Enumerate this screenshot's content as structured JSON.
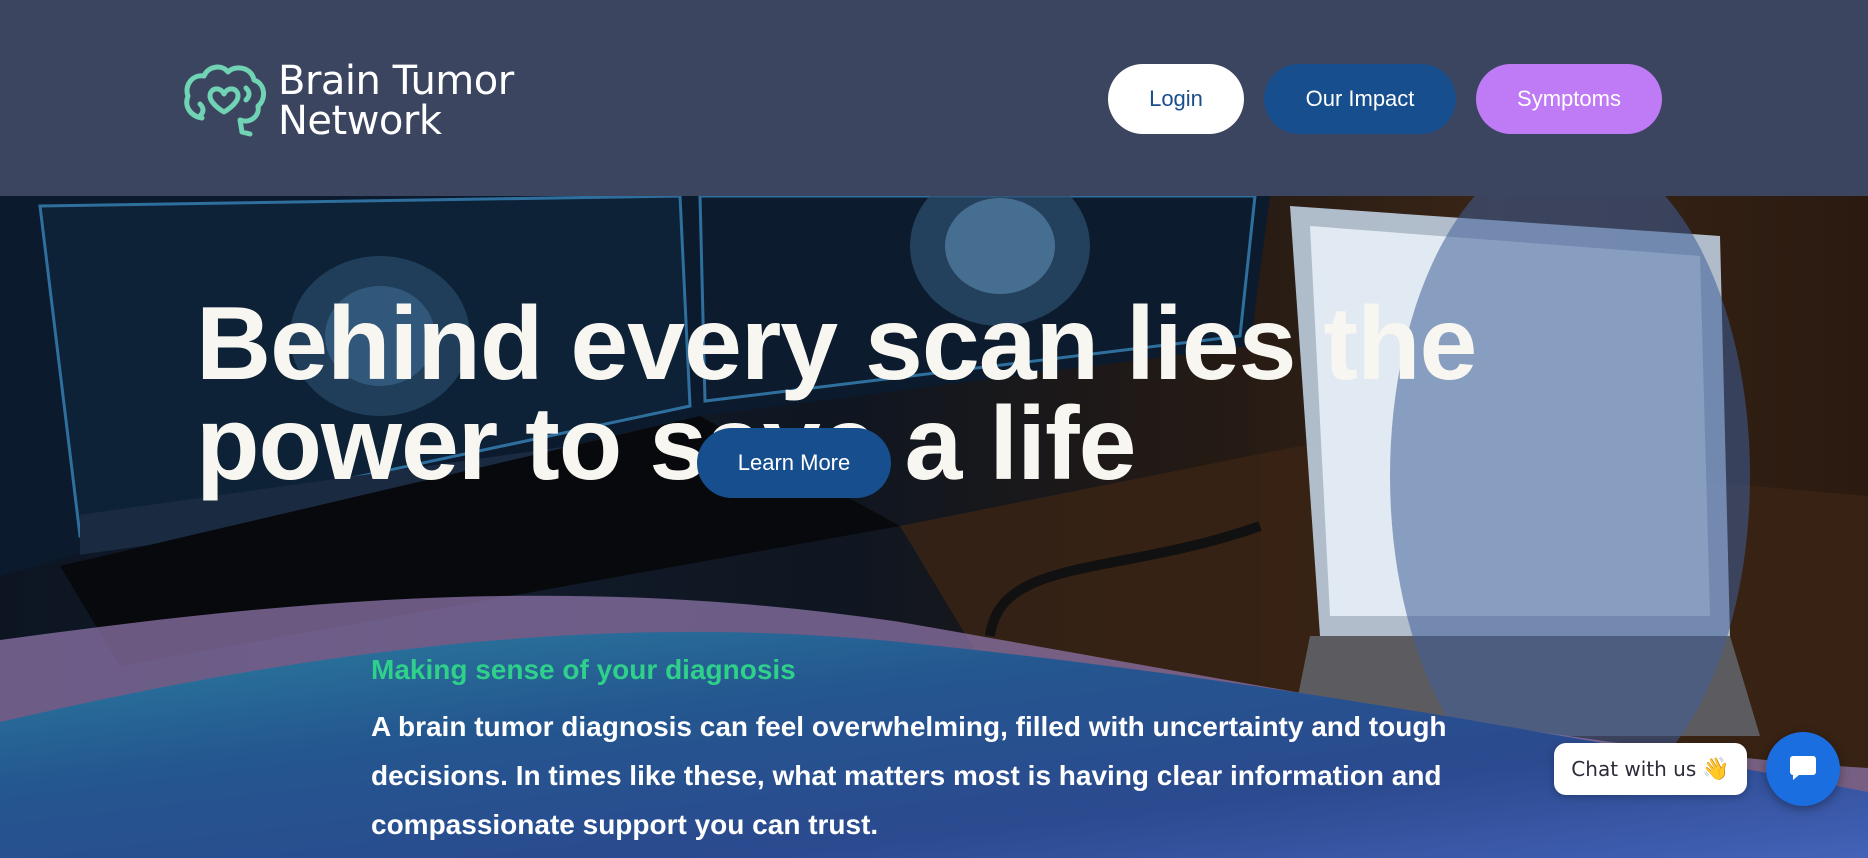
{
  "header": {
    "logo": {
      "line1": "Brain Tumor",
      "line2": "Network",
      "icon": "brain-heart-icon",
      "icon_color": "#6fd3b4"
    },
    "nav": {
      "login": "Login",
      "impact": "Our Impact",
      "symptoms": "Symptoms"
    }
  },
  "hero": {
    "headline": "Behind every scan lies the power to save a life",
    "cta": "Learn More"
  },
  "intro": {
    "kicker": "Making sense of your diagnosis",
    "body": "A brain tumor diagnosis can feel overwhelming, filled with uncertainty and tough decisions. In times like these, what matters most is having clear information and compassionate support you can trust."
  },
  "chat": {
    "label": "Chat with us",
    "emoji": "👋",
    "icon": "chat-icon"
  },
  "colors": {
    "header_bg": "#3c4560",
    "primary_blue": "#174e8e",
    "purple": "#bf7af5",
    "green": "#2ed08a",
    "chat_blue": "#1b6ee0"
  }
}
